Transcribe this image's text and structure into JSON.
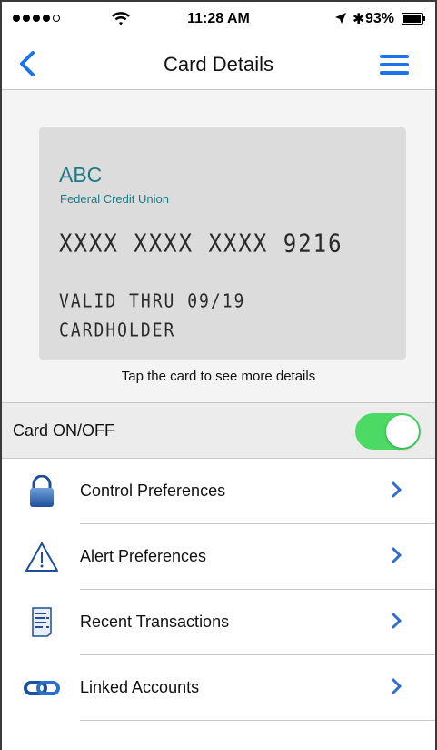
{
  "status_bar": {
    "time": "11:28 AM",
    "battery_percent_label": "93%",
    "battery_level": 0.93,
    "signal_bars_filled": 4,
    "signal_bars_total": 5
  },
  "nav": {
    "title": "Card Details",
    "accent_color": "#1a73e8"
  },
  "card": {
    "bank_name": "ABC",
    "bank_subtitle": "Federal Credit Union",
    "number": "XXXX XXXX XXXX 9216",
    "valid_thru": "VALID THRU 09/19",
    "holder": "CARDHOLDER",
    "tap_hint": "Tap the card to see more details"
  },
  "card_toggle": {
    "label": "Card ON/OFF",
    "on": true,
    "on_color": "#4cd964"
  },
  "menu_items": [
    {
      "label": "Control Preferences",
      "icon": "lock-icon"
    },
    {
      "label": "Alert Preferences",
      "icon": "warning-icon"
    },
    {
      "label": "Recent Transactions",
      "icon": "receipt-icon"
    },
    {
      "label": "Linked Accounts",
      "icon": "link-icon"
    }
  ]
}
